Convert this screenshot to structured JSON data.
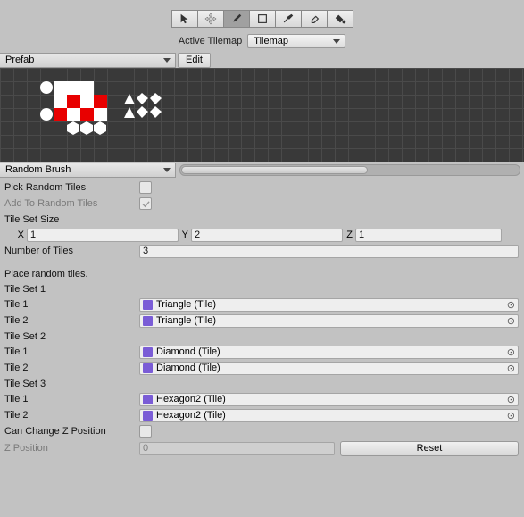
{
  "toolbar": {
    "active_tilemap_label": "Active Tilemap",
    "active_tilemap_value": "Tilemap"
  },
  "prefab": {
    "label": "Prefab",
    "edit": "Edit"
  },
  "brush": {
    "label": "Random Brush"
  },
  "props": {
    "pick_random": "Pick Random Tiles",
    "add_random": "Add To Random Tiles",
    "tile_set_size": "Tile Set Size",
    "x": "X",
    "y": "Y",
    "z": "Z",
    "x_val": "1",
    "y_val": "2",
    "z_val": "1",
    "num_tiles_label": "Number of Tiles",
    "num_tiles_val": "3",
    "place_header": "Place random tiles.",
    "can_change_z": "Can Change Z Position",
    "z_pos_label": "Z Position",
    "z_pos_val": "0",
    "reset": "Reset"
  },
  "tilesets": [
    {
      "header": "Tile Set 1",
      "tiles": [
        {
          "label": "Tile 1",
          "value": "Triangle (Tile)"
        },
        {
          "label": "Tile 2",
          "value": "Triangle (Tile)"
        }
      ]
    },
    {
      "header": "Tile Set 2",
      "tiles": [
        {
          "label": "Tile 1",
          "value": "Diamond (Tile)"
        },
        {
          "label": "Tile 2",
          "value": "Diamond (Tile)"
        }
      ]
    },
    {
      "header": "Tile Set 3",
      "tiles": [
        {
          "label": "Tile 1",
          "value": "Hexagon2 (Tile)"
        },
        {
          "label": "Tile 2",
          "value": "Hexagon2 (Tile)"
        }
      ]
    }
  ]
}
